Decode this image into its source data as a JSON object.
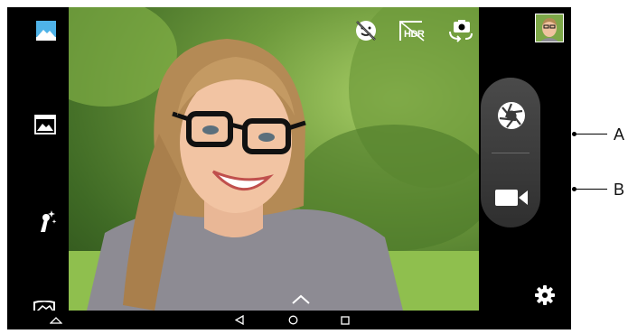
{
  "quick_settings": {
    "hdr_label": "HDR",
    "icons": [
      "face-beauty-off-icon",
      "hdr-icon",
      "switch-camera-icon"
    ]
  },
  "left_modes": [
    "gallery-mode-icon",
    "panorama-mode-icon",
    "effects-mode-icon",
    "wide-selfie-icon"
  ],
  "capture": {
    "icons": [
      "shutter-icon",
      "video-record-icon"
    ]
  },
  "callouts": {
    "a": "A",
    "b": "B"
  },
  "colors": {
    "accent": "#4fb3e8",
    "capture_button": "#3a3a3a",
    "chrome": "#000000"
  }
}
